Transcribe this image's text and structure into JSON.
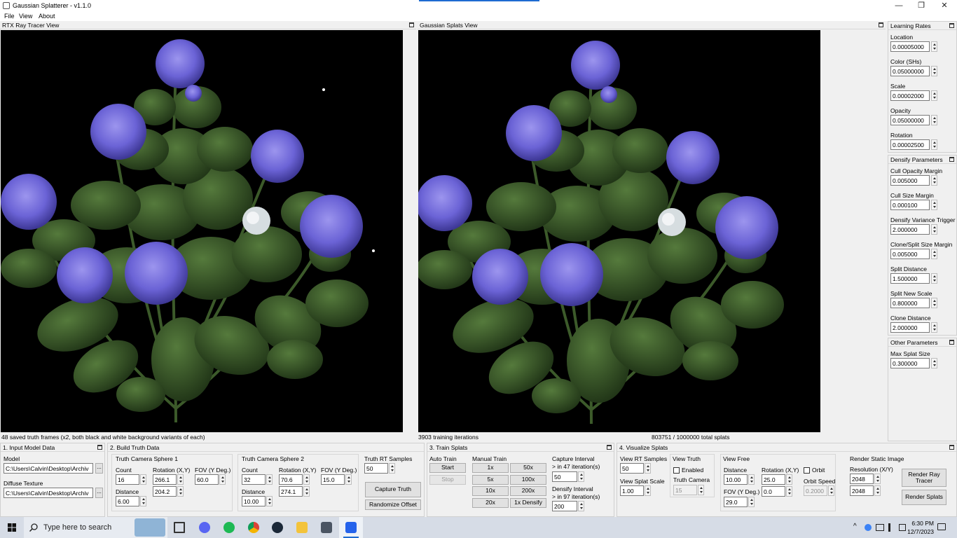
{
  "window": {
    "title": "Gaussian Splatterer - v1.1.0",
    "min": "—",
    "max": "❐",
    "close": "✕"
  },
  "menu": {
    "file": "File",
    "view": "View",
    "about": "About"
  },
  "rtx": {
    "title": "RTX Ray Tracer View",
    "status": "48 saved truth frames (x2, both black and white background variants of each)"
  },
  "gs": {
    "title": "Gaussian Splats View",
    "status_iter": "3903 training iterations",
    "status_splats": "803751 / 1000000 total splats"
  },
  "learning": {
    "title": "Learning Rates",
    "location_label": "Location",
    "location": "0.00005000",
    "color_label": "Color (SHs)",
    "color": "0.05000000",
    "scale_label": "Scale",
    "scale": "0.00002000",
    "opacity_label": "Opacity",
    "opacity": "0.05000000",
    "rotation_label": "Rotation",
    "rotation": "0.00002500"
  },
  "densify": {
    "title": "Densify Parameters",
    "cull_opacity_label": "Cull Opacity Margin",
    "cull_opacity": "0.005000",
    "cull_size_label": "Cull Size Margin",
    "cull_size": "0.000100",
    "variance_label": "Densify Variance Trigger",
    "variance": "2.000000",
    "clone_split_label": "Clone/Split Size Margin",
    "clone_split": "0.005000",
    "split_dist_label": "Split Distance",
    "split_dist": "1.500000",
    "split_scale_label": "Split New Scale",
    "split_scale": "0.800000",
    "clone_dist_label": "Clone Distance",
    "clone_dist": "2.000000"
  },
  "other": {
    "title": "Other Parameters",
    "max_splat_label": "Max Splat Size",
    "max_splat": "0.300000"
  },
  "input": {
    "title": "1. Input Model Data",
    "model_label": "Model",
    "model_path": "C:\\Users\\Calvin\\Desktop\\Archiv",
    "texture_label": "Diffuse Texture",
    "texture_path": "C:\\Users\\Calvin\\Desktop\\Archiv",
    "browse": "..."
  },
  "build": {
    "title": "2. Build Truth Data",
    "s1": {
      "title": "Truth Camera Sphere 1",
      "count_label": "Count",
      "count": "16",
      "rot_label": "Rotation (X,Y)",
      "rot_x": "266.1",
      "rot_y": "204.2",
      "fov_label": "FOV (Y Deg.)",
      "fov": "60.0",
      "dist_label": "Distance",
      "dist": "6.00"
    },
    "s2": {
      "title": "Truth Camera Sphere 2",
      "count_label": "Count",
      "count": "32",
      "rot_label": "Rotation (X,Y)",
      "rot_x": "70.6",
      "rot_y": "274.1",
      "fov_label": "FOV (Y Deg.)",
      "fov": "15.0",
      "dist_label": "Distance",
      "dist": "10.00"
    },
    "rt_label": "Truth RT Samples",
    "rt": "50",
    "capture": "Capture Truth",
    "randomize": "Randomize Offset"
  },
  "train": {
    "title": "3. Train Splats",
    "auto_label": "Auto Train",
    "start": "Start",
    "stop": "Stop",
    "manual_label": "Manual Train",
    "b1": "1x",
    "b5": "5x",
    "b10": "10x",
    "b20": "20x",
    "b50": "50x",
    "b100": "100x",
    "b200": "200x",
    "bdens": "1x Densify",
    "cap_label1": "Capture Interval",
    "cap_label2": "> in 47 iteration(s)",
    "cap": "50",
    "dens_label1": "Densify Interval",
    "dens_label2": "> in 97 iteration(s)",
    "dens": "200"
  },
  "visual": {
    "title": "4. Visualize Splats",
    "rt_label": "View RT Samples",
    "rt": "50",
    "scale_label": "View Splat Scale",
    "scale": "1.00",
    "truth_label": "View Truth",
    "enabled_label": "Enabled",
    "cam_label": "Truth Camera",
    "cam": "15",
    "free_label": "View Free",
    "dist_label": "Distance",
    "dist": "10.00",
    "rot_label": "Rotation (X,Y)",
    "rot_x": "25.0",
    "rot_y": "0.0",
    "fov_label": "FOV (Y Deg.)",
    "fov": "29.0",
    "orbit_label": "Orbit",
    "speed_label": "Orbit Speed",
    "speed": "0.2000",
    "render_label": "Render Static Image",
    "res_label": "Resolution (X/Y)",
    "res_x": "2048",
    "res_y": "2048",
    "render_rt": "Render Ray Tracer",
    "render_splats": "Render Splats"
  },
  "taskbar": {
    "search": "Type here to search",
    "time": "6:30 PM",
    "date": "12/7/2023"
  },
  "colors": {
    "petal": "#6b63d6",
    "petal_light": "#8e86ea",
    "leaf": "#2f4a22",
    "leaf_light": "#4a6a35",
    "taskbar": "#d6dce6",
    "accent": "#1e6bd1"
  }
}
